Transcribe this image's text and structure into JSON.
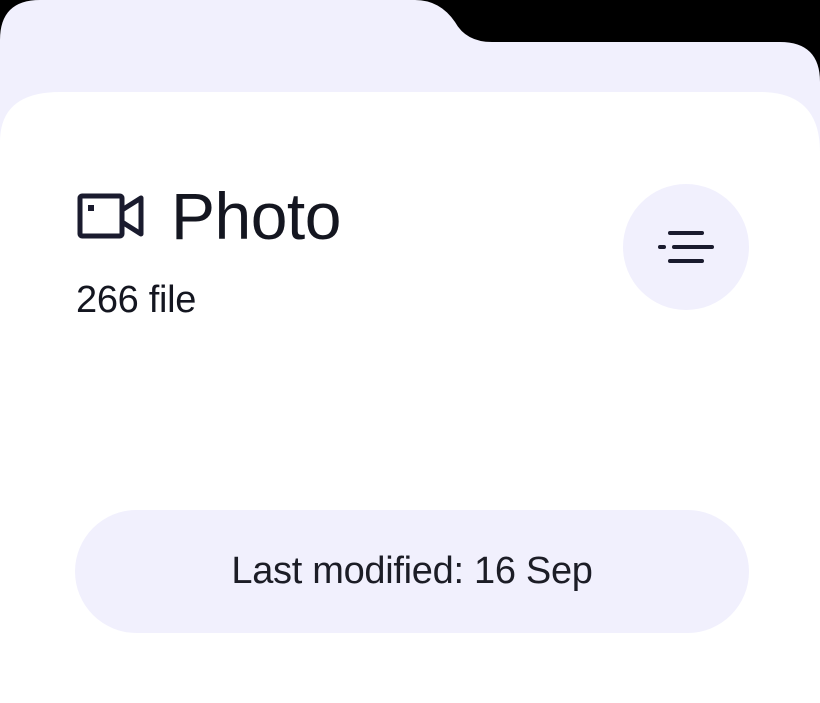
{
  "card": {
    "icon": "video-camera-icon",
    "title": "Photo",
    "file_count": "266 file",
    "menu_icon": "filter-lines-icon",
    "last_modified": "Last modified: 16 Sep"
  },
  "colors": {
    "folder_tab": "#f1f0fd",
    "card_background": "#ffffff",
    "pill_background": "#f1f0fd",
    "text_primary": "#141620",
    "icon_stroke": "#1a1b2e"
  }
}
